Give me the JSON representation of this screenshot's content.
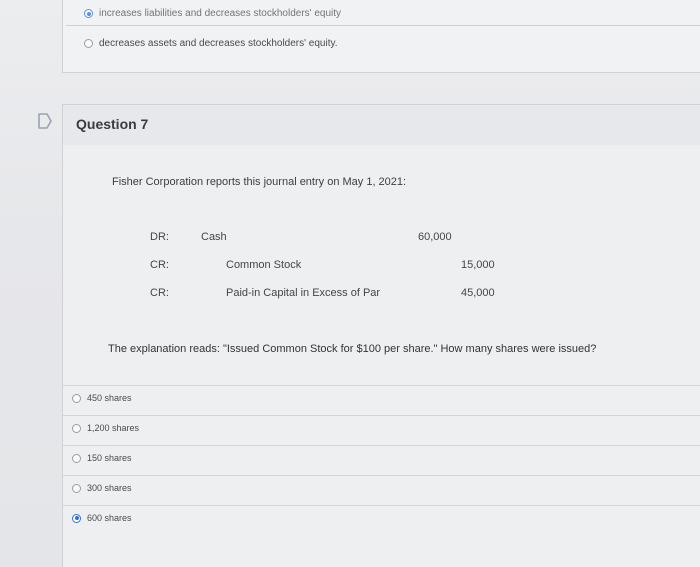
{
  "previous_question": {
    "option_selected_text": "increases liabilities and decreases stockholders' equity",
    "option_other_text": "decreases assets and decreases stockholders' equity."
  },
  "question": {
    "title": "Question 7",
    "stem": "Fisher Corporation reports this journal entry on May 1, 2021:",
    "journal_entry": [
      {
        "type": "DR:",
        "account": "Cash",
        "debit": "60,000",
        "credit": ""
      },
      {
        "type": "CR:",
        "account": "Common Stock",
        "debit": "",
        "credit": "15,000"
      },
      {
        "type": "CR:",
        "account": "Paid-in Capital in Excess of Par",
        "debit": "",
        "credit": "45,000"
      }
    ],
    "explanation": "The explanation reads: \"Issued Common Stock for $100 per share.\" How many shares were issued?"
  },
  "answers": [
    {
      "label": "450 shares",
      "selected": false
    },
    {
      "label": "1,200 shares",
      "selected": false
    },
    {
      "label": "150 shares",
      "selected": false
    },
    {
      "label": "300 shares",
      "selected": false
    },
    {
      "label": "600 shares",
      "selected": true
    }
  ],
  "colors": {
    "accent": "#2f6fd6",
    "background": "#e6e7ea"
  },
  "icons": {
    "flag": "flag-icon"
  }
}
